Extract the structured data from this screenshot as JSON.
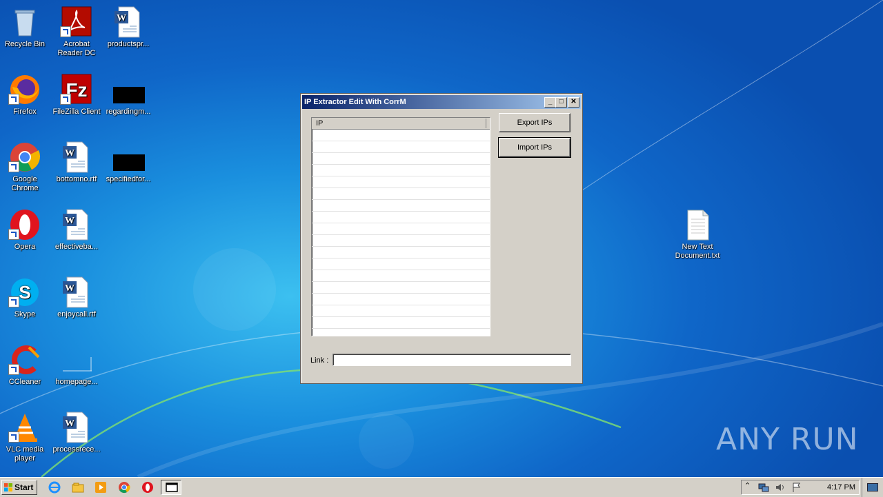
{
  "desktop": {
    "icons": [
      {
        "label": "Recycle Bin",
        "icon": "recycle-bin-icon"
      },
      {
        "label": "Acrobat Reader DC",
        "icon": "acrobat-icon"
      },
      {
        "label": "productspr...",
        "icon": "word-document-icon"
      },
      {
        "label": "Firefox",
        "icon": "firefox-icon"
      },
      {
        "label": "FileZilla Client",
        "icon": "filezilla-icon"
      },
      {
        "label": "regardingm...",
        "icon": "redacted-file-icon"
      },
      {
        "label": "Google Chrome",
        "icon": "chrome-icon"
      },
      {
        "label": "bottomno.rtf",
        "icon": "word-document-icon"
      },
      {
        "label": "specifiedfor...",
        "icon": "redacted-file-icon"
      },
      {
        "label": "Opera",
        "icon": "opera-icon"
      },
      {
        "label": "effectiveba...",
        "icon": "word-document-icon"
      },
      {
        "label": "Skype",
        "icon": "skype-icon"
      },
      {
        "label": "enjoycall.rtf",
        "icon": "word-document-icon"
      },
      {
        "label": "CCleaner",
        "icon": "ccleaner-icon"
      },
      {
        "label": "homepage...",
        "icon": "blank-file-icon"
      },
      {
        "label": "VLC media player",
        "icon": "vlc-icon"
      },
      {
        "label": "processrece...",
        "icon": "word-document-icon"
      },
      {
        "label": "New Text Document.txt",
        "icon": "text-file-icon"
      }
    ]
  },
  "window": {
    "title": "IP Extractor Edit With CorrM",
    "list_header": "IP",
    "export_label": "Export IPs",
    "import_label": "Import IPs",
    "link_label": "Link :",
    "link_value": ""
  },
  "taskbar": {
    "start_label": "Start",
    "clock": "4:17 PM"
  },
  "watermark": "ANY RUN",
  "colors": {
    "titlebar_start": "#0a246a",
    "titlebar_end": "#a6caf0",
    "face": "#d4d0c8"
  }
}
